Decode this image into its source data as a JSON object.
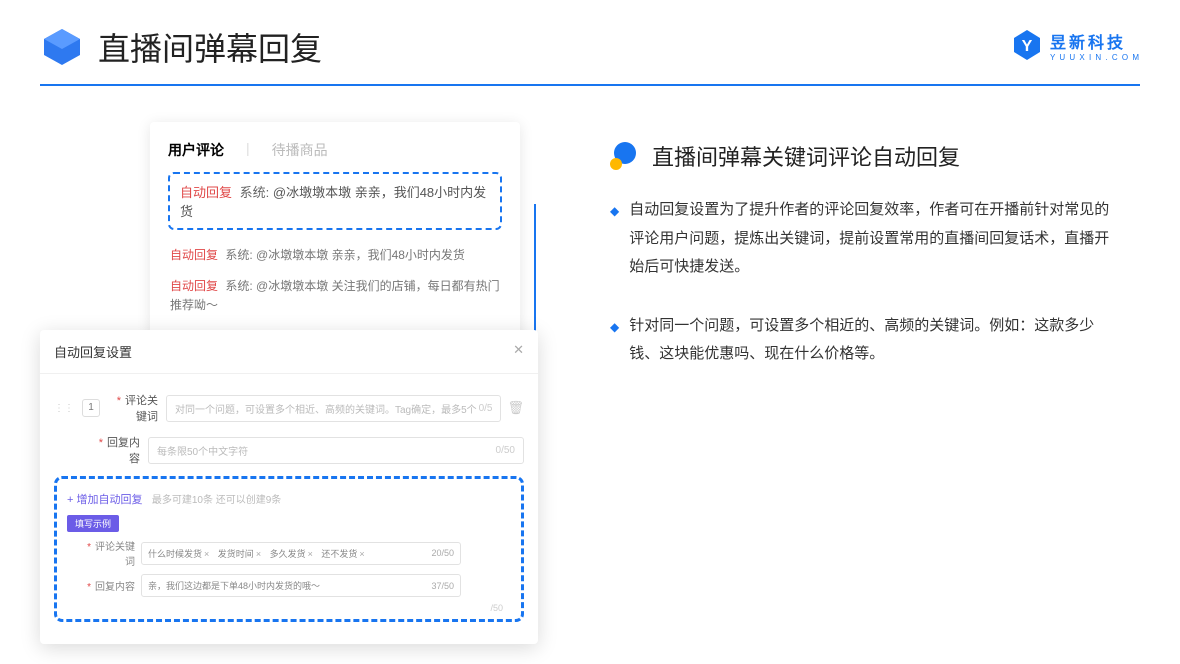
{
  "header": {
    "title": "直播间弹幕回复",
    "company_cn": "昱新科技",
    "company_en": "Y U U X I N . C O M"
  },
  "comments": {
    "tab_active": "用户评论",
    "tab_inactive": "待播商品",
    "reply_tag": "自动回复",
    "sys_label": "系统:",
    "line1": "@冰墩墩本墩 亲亲，我们48小时内发货",
    "line2": "@冰墩墩本墩 亲亲，我们48小时内发货",
    "line3": "@冰墩墩本墩 关注我们的店铺，每日都有热门推荐呦～"
  },
  "settings": {
    "title": "自动回复设置",
    "row_num": "1",
    "kw_label": "评论关键词",
    "kw_placeholder": "对同一个问题，可设置多个相近、高频的关键词。Tag确定，最多5个",
    "kw_count": "0/5",
    "content_label": "回复内容",
    "content_placeholder": "每条限50个中文字符",
    "content_count": "0/50",
    "add_link": "+ 增加自动回复",
    "add_note": "最多可建10条 还可以创建9条",
    "chip": "填写示例",
    "ex_kw_label": "评论关键词",
    "ex_tags": [
      "什么时候发货",
      "发货时间",
      "多久发货",
      "还不发货"
    ],
    "ex_kw_count": "20/50",
    "ex_content_label": "回复内容",
    "ex_content_text": "亲，我们这边都是下单48小时内发货的哦～",
    "ex_content_count": "37/50",
    "ghost_count": "/50"
  },
  "right": {
    "section_title": "直播间弹幕关键词评论自动回复",
    "bullet1": "自动回复设置为了提升作者的评论回复效率，作者可在开播前针对常见的评论用户问题，提炼出关键词，提前设置常用的直播间回复话术，直播开始后可快捷发送。",
    "bullet2": "针对同一个问题，可设置多个相近的、高频的关键词。例如：这款多少钱、这块能优惠吗、现在什么价格等。"
  }
}
